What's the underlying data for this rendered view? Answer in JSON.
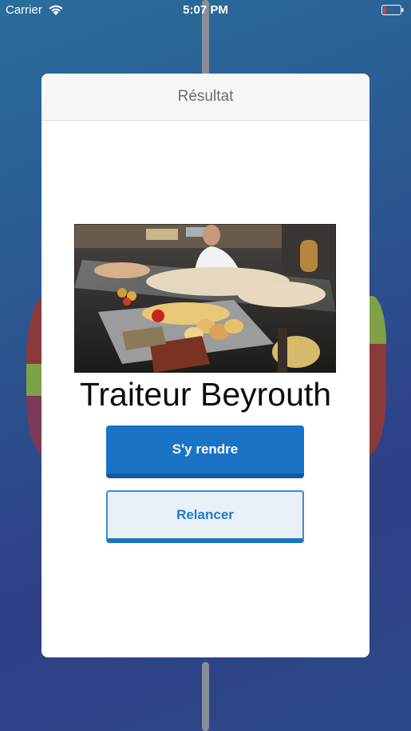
{
  "status_bar": {
    "carrier": "Carrier",
    "time": "5:07 PM",
    "wifi_icon": "wifi-icon",
    "battery_icon": "battery-low-icon"
  },
  "modal": {
    "title": "Résultat",
    "restaurant_name": "Traiteur Beyrouth",
    "primary_button_label": "S'y rendre",
    "secondary_button_label": "Relancer"
  },
  "colors": {
    "primary": "#1b73c6",
    "battery_low": "#e0373b"
  }
}
